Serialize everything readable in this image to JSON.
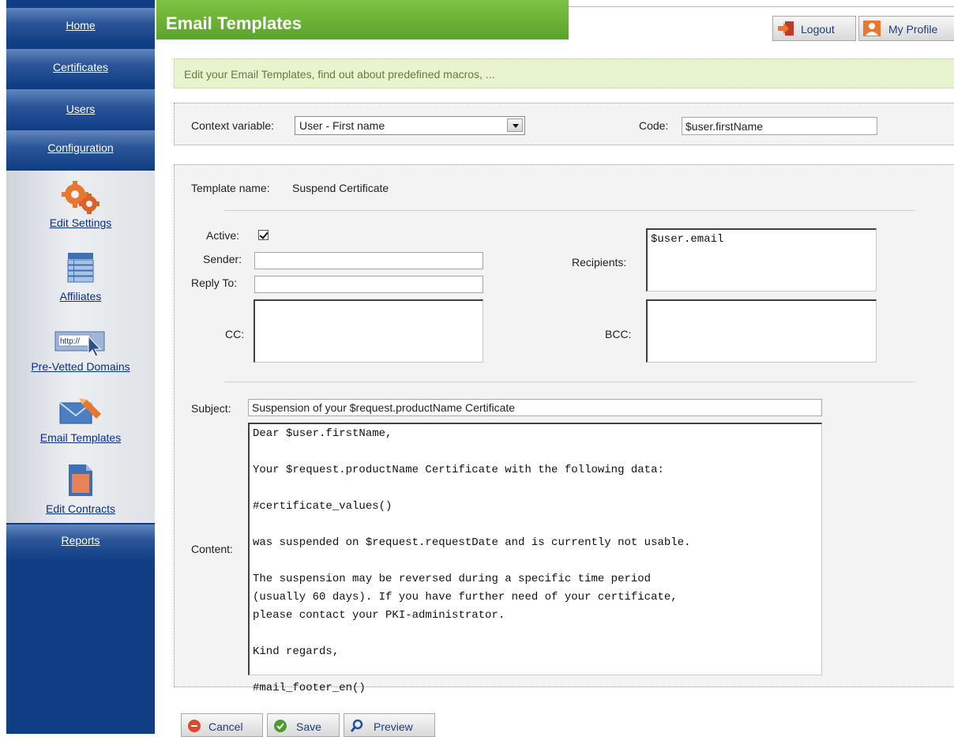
{
  "sidebar": {
    "nav": [
      {
        "label": "Home"
      },
      {
        "label": "Certificates"
      },
      {
        "label": "Users"
      },
      {
        "label": "Configuration"
      }
    ],
    "settings_items": [
      {
        "label": "Edit Settings",
        "icon": "gears-icon"
      },
      {
        "label": "Affiliates",
        "icon": "database-icon"
      },
      {
        "label": "Pre-Vetted Domains",
        "icon": "http-url-icon"
      },
      {
        "label": "Email Templates",
        "icon": "email-templates-icon"
      },
      {
        "label": "Edit Contracts",
        "icon": "contract-icon"
      }
    ],
    "reports": {
      "label": "Reports"
    }
  },
  "header": {
    "title": "Email Templates",
    "logout_label": "Logout",
    "profile_label": "My Profile"
  },
  "info": {
    "text": "Edit your Email Templates, find out about predefined macros, ..."
  },
  "context": {
    "variable_label": "Context variable:",
    "variable_value": "User - First name",
    "code_label": "Code:",
    "code_value": "$user.firstName"
  },
  "template": {
    "name_label": "Template name:",
    "name_value": "Suspend Certificate",
    "active_label": "Active:",
    "active_checked": true,
    "sender_label": "Sender:",
    "sender_value": "",
    "reply_to_label": "Reply To:",
    "reply_to_value": "",
    "cc_label": "CC:",
    "cc_value": "",
    "recipients_label": "Recipients:",
    "recipients_value": "$user.email",
    "bcc_label": "BCC:",
    "bcc_value": "",
    "subject_label": "Subject:",
    "subject_value": "Suspension of your $request.productName Certificate",
    "content_label": "Content:",
    "content_lines": [
      "Dear $user.firstName,",
      "",
      "Your $request.productName Certificate with the following data:",
      "",
      "#certificate_values()",
      "",
      "was suspended on $request.requestDate and is currently not usable.",
      "",
      "The suspension may be reversed during a specific time period",
      "(usually 60 days). If you have further need of your certificate,",
      "please contact your PKI-administrator.",
      "",
      "Kind regards,",
      "",
      "#mail_footer_en()"
    ]
  },
  "actions": {
    "cancel_label": "Cancel",
    "save_label": "Save",
    "preview_label": "Preview"
  },
  "colors": {
    "sidebar": "#103e85",
    "title_bar": "#6cb236",
    "info_bar": "#e9f4cf",
    "link": "#0a2f8a"
  }
}
